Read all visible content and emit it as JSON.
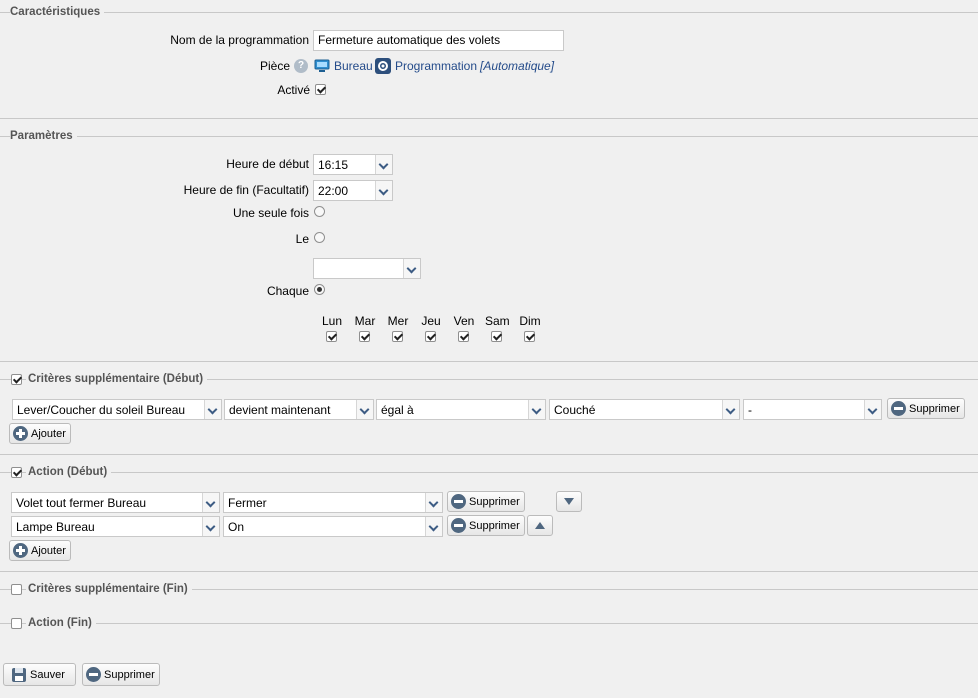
{
  "caracteristiques": {
    "legend": "Caractéristiques",
    "name_label": "Nom de la programmation",
    "name_value": "Fermeture automatique des volets",
    "room_label": "Pièce",
    "room_link": "Bureau",
    "prog_link": "Programmation",
    "prog_type": "[Automatique]",
    "active_label": "Activé",
    "active_checked": true
  },
  "parametres": {
    "legend": "Paramètres",
    "start_label": "Heure de début",
    "start_value": "16:15",
    "end_label": "Heure de fin (Facultatif)",
    "end_value": "22:00",
    "once_label": "Une seule fois",
    "on_label": "Le",
    "on_date_value": "",
    "each_label": "Chaque",
    "days": [
      {
        "label": "Lun",
        "checked": true
      },
      {
        "label": "Mar",
        "checked": true
      },
      {
        "label": "Mer",
        "checked": true
      },
      {
        "label": "Jeu",
        "checked": true
      },
      {
        "label": "Ven",
        "checked": true
      },
      {
        "label": "Sam",
        "checked": true
      },
      {
        "label": "Dim",
        "checked": true
      }
    ]
  },
  "criteres_debut": {
    "legend": "Critères supplémentaire (Début)",
    "checked": true,
    "row": {
      "device": "Lever/Coucher du soleil Bureau",
      "condition": "devient maintenant",
      "operator": "égal à",
      "value": "Couché",
      "extra": "-",
      "delete_label": "Supprimer"
    },
    "add_label": "Ajouter"
  },
  "action_debut": {
    "legend": "Action (Début)",
    "checked": true,
    "rows": [
      {
        "device": "Volet tout fermer Bureau",
        "action": "Fermer",
        "delete_label": "Supprimer"
      },
      {
        "device": "Lampe Bureau",
        "action": "On",
        "delete_label": "Supprimer"
      }
    ],
    "add_label": "Ajouter"
  },
  "criteres_fin": {
    "legend": "Critères supplémentaire (Fin)",
    "checked": false
  },
  "action_fin": {
    "legend": "Action (Fin)",
    "checked": false
  },
  "footer": {
    "save_label": "Sauver",
    "delete_label": "Supprimer"
  }
}
